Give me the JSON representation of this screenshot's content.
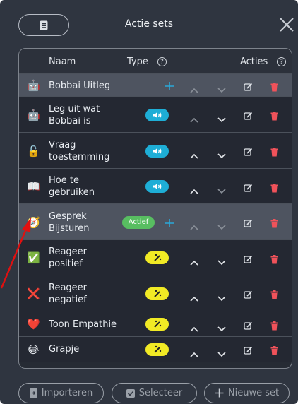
{
  "header": {
    "title": "Actie sets"
  },
  "columns": {
    "naam": "Naam",
    "type": "Type",
    "acties": "Acties"
  },
  "rows": [
    {
      "emoji": "🤖",
      "name_lines": [
        "Bobbai Uitleg",
        ""
      ],
      "group": true,
      "badge": "none"
    },
    {
      "emoji": "🤖",
      "name_lines": [
        "Leg uit wat",
        "Bobbai is"
      ],
      "group": false,
      "badge": "speaker"
    },
    {
      "emoji": "🔓",
      "name_lines": [
        "Vraag",
        "toestemming"
      ],
      "group": false,
      "badge": "speaker"
    },
    {
      "emoji": "📖",
      "name_lines": [
        "Hoe te",
        "gebruiken"
      ],
      "group": false,
      "badge": "speaker"
    },
    {
      "emoji": "🧭",
      "name_lines": [
        "Gesprek",
        "Bijsturen"
      ],
      "group": true,
      "badge": "actief",
      "badge_text": "Actief"
    },
    {
      "emoji": "✅",
      "name_lines": [
        "Reageer",
        "positief"
      ],
      "group": false,
      "badge": "wand"
    },
    {
      "emoji": "❌",
      "name_lines": [
        "Reageer",
        "negatief"
      ],
      "group": false,
      "badge": "wand"
    },
    {
      "emoji": "❤️",
      "name_lines": [
        "Toon Empathie",
        ""
      ],
      "group": false,
      "badge": "wand"
    },
    {
      "emoji": "😂",
      "name_lines": [
        "Grapje",
        ""
      ],
      "group": false,
      "badge": "wand"
    }
  ],
  "footer": {
    "import_label": "Importeren",
    "select_label": "Selecteer",
    "new_set_label": "Nieuwe set"
  },
  "colors": {
    "panel": "#2f3540",
    "blue_badge": "#1eaed6",
    "yellow_badge": "#f1ea25",
    "green_badge": "#58be61",
    "delete": "#f0525a",
    "plus": "#2aa8d8",
    "arrow": "#e01010"
  }
}
